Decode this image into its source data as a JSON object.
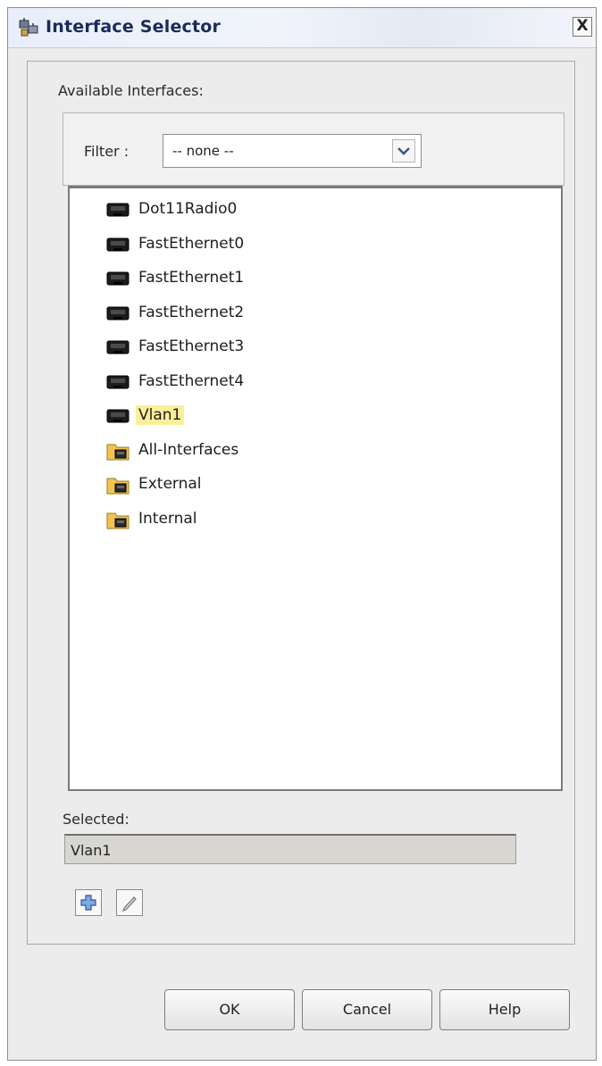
{
  "window": {
    "title": "Interface Selector",
    "close_glyph": "X"
  },
  "available": {
    "label": "Available Interfaces:",
    "filter": {
      "label": "Filter :",
      "value": "-- none --"
    }
  },
  "tree": {
    "items": [
      {
        "label": "Dot11Radio0",
        "icon": "interface-icon"
      },
      {
        "label": "FastEthernet0",
        "icon": "interface-icon"
      },
      {
        "label": "FastEthernet1",
        "icon": "interface-icon"
      },
      {
        "label": "FastEthernet2",
        "icon": "interface-icon"
      },
      {
        "label": "FastEthernet3",
        "icon": "interface-icon"
      },
      {
        "label": "FastEthernet4",
        "icon": "interface-icon"
      },
      {
        "label": "Vlan1",
        "icon": "interface-icon",
        "selected": true
      },
      {
        "label": "All-Interfaces",
        "icon": "interface-group-icon"
      },
      {
        "label": "External",
        "icon": "interface-group-icon"
      },
      {
        "label": "Internal",
        "icon": "interface-group-icon"
      }
    ]
  },
  "selected": {
    "label": "Selected:",
    "value": "Vlan1"
  },
  "buttons": {
    "ok": "OK",
    "cancel": "Cancel",
    "help": "Help"
  },
  "colors": {
    "selection_highlight": "#fbef9a",
    "title_text": "#1a2a5a"
  }
}
